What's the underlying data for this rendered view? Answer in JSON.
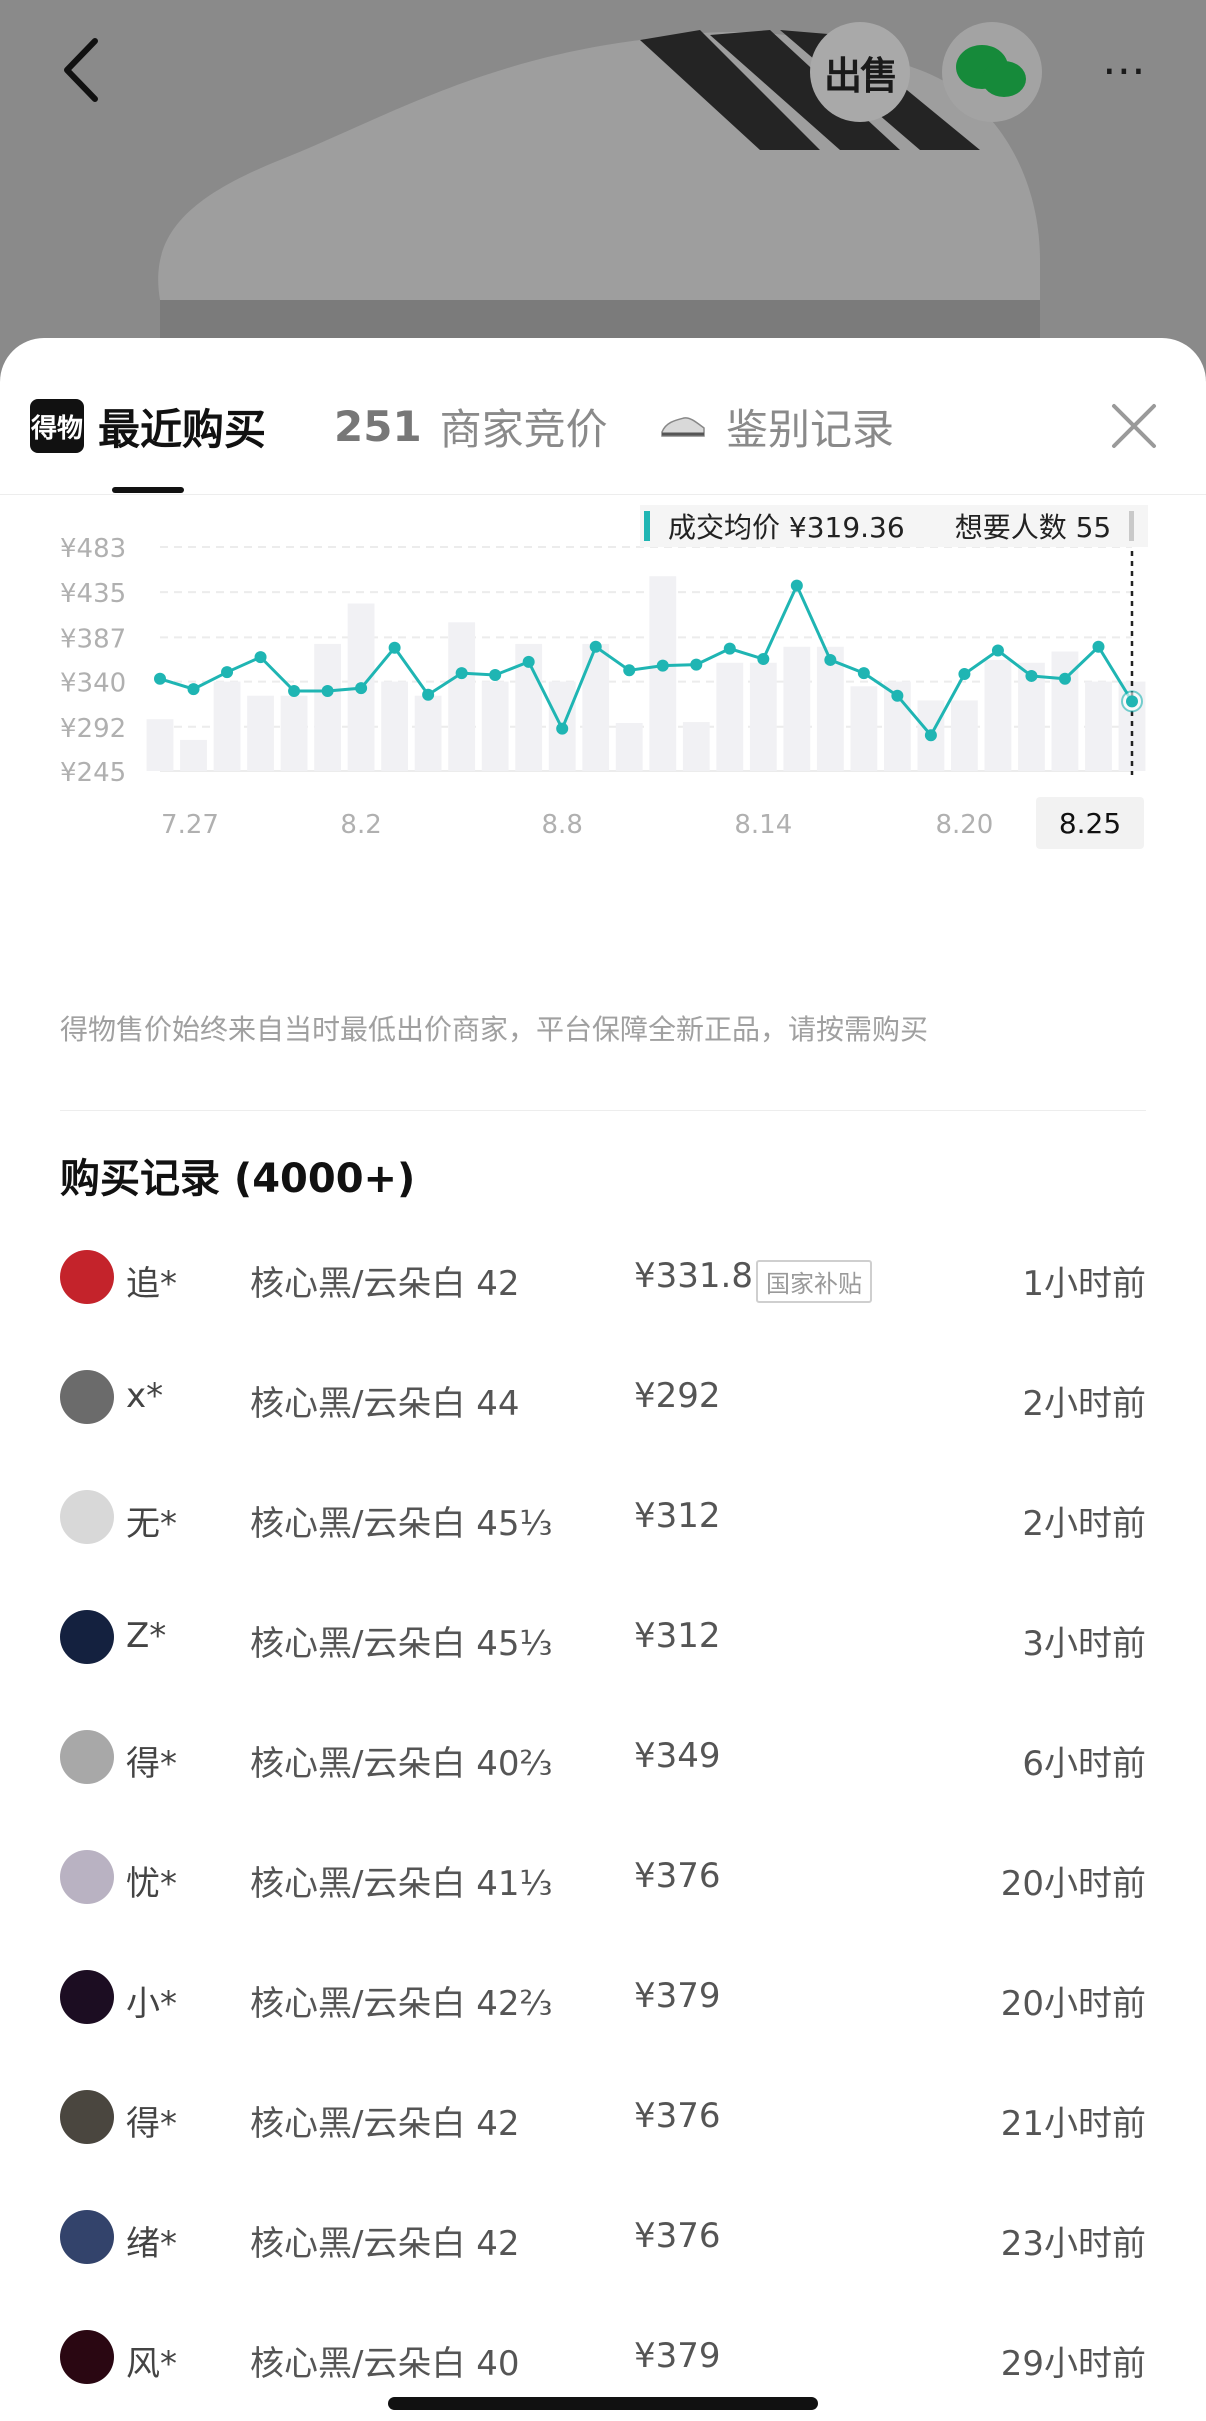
{
  "topbar": {
    "back_icon": "chevron-left-icon",
    "sell_label": "出售",
    "wechat_icon": "wechat-icon",
    "more_label": "⋯"
  },
  "tabs": [
    {
      "logo": "得物",
      "label": "最近购买",
      "active": true
    },
    {
      "count": "251",
      "label": "商家竞价",
      "active": false
    },
    {
      "icon": "sneaker-icon",
      "label": "鉴别记录",
      "active": false
    }
  ],
  "legend": {
    "avg_label": "成交均价 ¥319.36",
    "want_label": "想要人数 55"
  },
  "chart_data": {
    "type": "line",
    "y_ticks": [
      "¥483",
      "¥435",
      "¥387",
      "¥340",
      "¥292",
      "¥245"
    ],
    "ylim": [
      245,
      483
    ],
    "x_ticks": [
      "7.27",
      "8.2",
      "8.8",
      "8.14",
      "8.20",
      "8.25"
    ],
    "x_dates": [
      "7.27",
      "7.28",
      "7.29",
      "7.30",
      "7.31",
      "8.1",
      "8.2",
      "8.3",
      "8.4",
      "8.5",
      "8.6",
      "8.7",
      "8.8",
      "8.9",
      "8.10",
      "8.11",
      "8.12",
      "8.13",
      "8.14",
      "8.15",
      "8.16",
      "8.17",
      "8.18",
      "8.19",
      "8.20",
      "8.21",
      "8.22",
      "8.23",
      "8.24",
      "8.25"
    ],
    "line_values": [
      343,
      332,
      350,
      366,
      330,
      330,
      333,
      376,
      326,
      349,
      347,
      361,
      290,
      377,
      352,
      357,
      358,
      375,
      364,
      442,
      363,
      349,
      325,
      283,
      348,
      373,
      346,
      343,
      377,
      319
    ],
    "bar_values": [
      300,
      278,
      340,
      325,
      325,
      380,
      423,
      340,
      325,
      403,
      340,
      380,
      340,
      380,
      296,
      452,
      297,
      360,
      360,
      377,
      377,
      335,
      340,
      320,
      320,
      363,
      360,
      372,
      340,
      340
    ],
    "colors": {
      "line": "#1fb5b3",
      "bars": "#f1f1f4"
    },
    "grid": true,
    "selected": "8.25"
  },
  "note": "得物售价始终来自当时最低出价商家，平台保障全新正品，请按需购买",
  "records_title": "购买记录 (4000+)",
  "records": [
    {
      "name": "追*",
      "spec": "核心黑/云朵白 42",
      "price": "¥331.8",
      "tag": "国家补贴",
      "time": "1小时前",
      "avatar_color": "#c4232b"
    },
    {
      "name": "x*",
      "spec": "核心黑/云朵白 44",
      "price": "¥292",
      "tag": "",
      "time": "2小时前",
      "avatar_color": "#6b6b6b"
    },
    {
      "name": "无*",
      "spec": "核心黑/云朵白 45⅓",
      "price": "¥312",
      "tag": "",
      "time": "2小时前",
      "avatar_color": "#d8d8d8"
    },
    {
      "name": "Z*",
      "spec": "核心黑/云朵白 45⅓",
      "price": "¥312",
      "tag": "",
      "time": "3小时前",
      "avatar_color": "#14213f"
    },
    {
      "name": "得*",
      "spec": "核心黑/云朵白 40⅔",
      "price": "¥349",
      "tag": "",
      "time": "6小时前",
      "avatar_color": "#a8a8a8"
    },
    {
      "name": "忧*",
      "spec": "核心黑/云朵白 41⅓",
      "price": "¥376",
      "tag": "",
      "time": "20小时前",
      "avatar_color": "#b9b2c2"
    },
    {
      "name": "小*",
      "spec": "核心黑/云朵白 42⅔",
      "price": "¥379",
      "tag": "",
      "time": "20小时前",
      "avatar_color": "#1c0d22"
    },
    {
      "name": "得*",
      "spec": "核心黑/云朵白 42",
      "price": "¥376",
      "tag": "",
      "time": "21小时前",
      "avatar_color": "#4a463f"
    },
    {
      "name": "绪*",
      "spec": "核心黑/云朵白 42",
      "price": "¥376",
      "tag": "",
      "time": "23小时前",
      "avatar_color": "#33436b"
    },
    {
      "name": "风*",
      "spec": "核心黑/云朵白 40",
      "price": "¥379",
      "tag": "",
      "time": "29小时前",
      "avatar_color": "#2a0712"
    }
  ]
}
